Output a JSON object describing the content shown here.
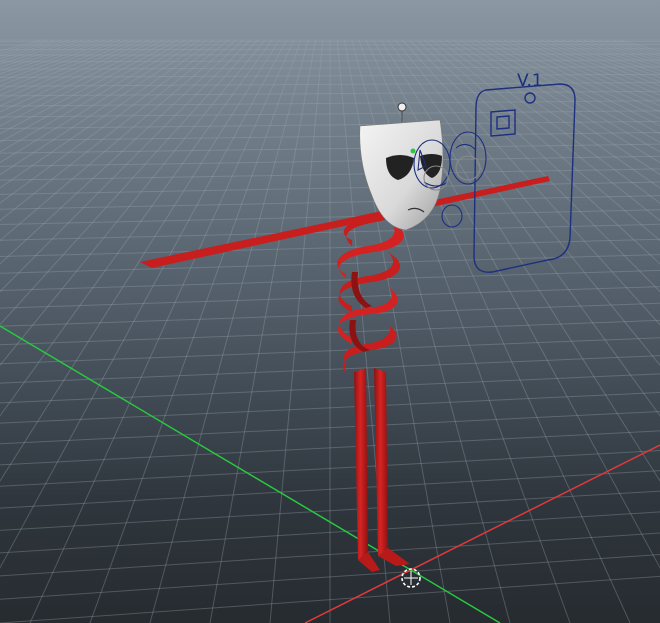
{
  "viewport": {
    "rig_label": "V.1",
    "colors": {
      "sky_top": "#8b98a3",
      "ground": "#262b30",
      "grid": "#9aa6b0",
      "axis_x": "#e03a3a",
      "axis_z": "#27c93f",
      "ribbon": "#c81e1e",
      "ribbon_dark": "#8d1212",
      "mask": "#eeeeee",
      "rig_curves": "#1e2f80"
    },
    "objects": [
      {
        "name": "mask-head",
        "icon": "mask"
      },
      {
        "name": "spring-ribbon",
        "icon": "spiral"
      },
      {
        "name": "face-rig-control",
        "icon": "rig-box"
      },
      {
        "name": "origin-pivot",
        "icon": "pivot"
      }
    ]
  }
}
